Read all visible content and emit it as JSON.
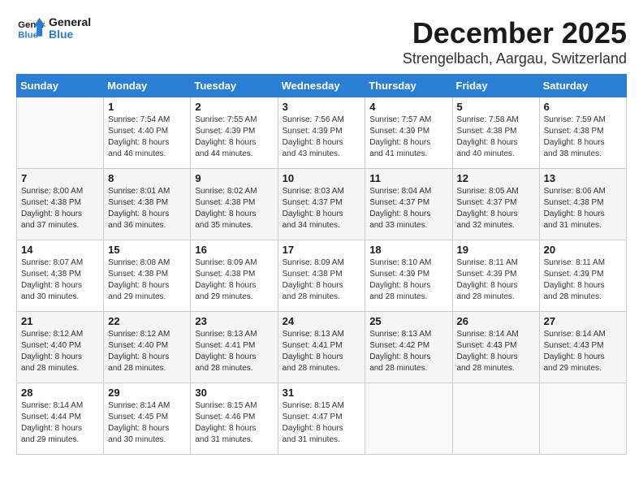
{
  "logo": {
    "line1": "General",
    "line2": "Blue"
  },
  "title": "December 2025",
  "location": "Strengelbach, Aargau, Switzerland",
  "weekdays": [
    "Sunday",
    "Monday",
    "Tuesday",
    "Wednesday",
    "Thursday",
    "Friday",
    "Saturday"
  ],
  "weeks": [
    [
      {
        "day": "",
        "info": ""
      },
      {
        "day": "1",
        "info": "Sunrise: 7:54 AM\nSunset: 4:40 PM\nDaylight: 8 hours\nand 46 minutes."
      },
      {
        "day": "2",
        "info": "Sunrise: 7:55 AM\nSunset: 4:39 PM\nDaylight: 8 hours\nand 44 minutes."
      },
      {
        "day": "3",
        "info": "Sunrise: 7:56 AM\nSunset: 4:39 PM\nDaylight: 8 hours\nand 43 minutes."
      },
      {
        "day": "4",
        "info": "Sunrise: 7:57 AM\nSunset: 4:39 PM\nDaylight: 8 hours\nand 41 minutes."
      },
      {
        "day": "5",
        "info": "Sunrise: 7:58 AM\nSunset: 4:38 PM\nDaylight: 8 hours\nand 40 minutes."
      },
      {
        "day": "6",
        "info": "Sunrise: 7:59 AM\nSunset: 4:38 PM\nDaylight: 8 hours\nand 38 minutes."
      }
    ],
    [
      {
        "day": "7",
        "info": "Sunrise: 8:00 AM\nSunset: 4:38 PM\nDaylight: 8 hours\nand 37 minutes."
      },
      {
        "day": "8",
        "info": "Sunrise: 8:01 AM\nSunset: 4:38 PM\nDaylight: 8 hours\nand 36 minutes."
      },
      {
        "day": "9",
        "info": "Sunrise: 8:02 AM\nSunset: 4:38 PM\nDaylight: 8 hours\nand 35 minutes."
      },
      {
        "day": "10",
        "info": "Sunrise: 8:03 AM\nSunset: 4:37 PM\nDaylight: 8 hours\nand 34 minutes."
      },
      {
        "day": "11",
        "info": "Sunrise: 8:04 AM\nSunset: 4:37 PM\nDaylight: 8 hours\nand 33 minutes."
      },
      {
        "day": "12",
        "info": "Sunrise: 8:05 AM\nSunset: 4:37 PM\nDaylight: 8 hours\nand 32 minutes."
      },
      {
        "day": "13",
        "info": "Sunrise: 8:06 AM\nSunset: 4:38 PM\nDaylight: 8 hours\nand 31 minutes."
      }
    ],
    [
      {
        "day": "14",
        "info": "Sunrise: 8:07 AM\nSunset: 4:38 PM\nDaylight: 8 hours\nand 30 minutes."
      },
      {
        "day": "15",
        "info": "Sunrise: 8:08 AM\nSunset: 4:38 PM\nDaylight: 8 hours\nand 29 minutes."
      },
      {
        "day": "16",
        "info": "Sunrise: 8:09 AM\nSunset: 4:38 PM\nDaylight: 8 hours\nand 29 minutes."
      },
      {
        "day": "17",
        "info": "Sunrise: 8:09 AM\nSunset: 4:38 PM\nDaylight: 8 hours\nand 28 minutes."
      },
      {
        "day": "18",
        "info": "Sunrise: 8:10 AM\nSunset: 4:39 PM\nDaylight: 8 hours\nand 28 minutes."
      },
      {
        "day": "19",
        "info": "Sunrise: 8:11 AM\nSunset: 4:39 PM\nDaylight: 8 hours\nand 28 minutes."
      },
      {
        "day": "20",
        "info": "Sunrise: 8:11 AM\nSunset: 4:39 PM\nDaylight: 8 hours\nand 28 minutes."
      }
    ],
    [
      {
        "day": "21",
        "info": "Sunrise: 8:12 AM\nSunset: 4:40 PM\nDaylight: 8 hours\nand 28 minutes."
      },
      {
        "day": "22",
        "info": "Sunrise: 8:12 AM\nSunset: 4:40 PM\nDaylight: 8 hours\nand 28 minutes."
      },
      {
        "day": "23",
        "info": "Sunrise: 8:13 AM\nSunset: 4:41 PM\nDaylight: 8 hours\nand 28 minutes."
      },
      {
        "day": "24",
        "info": "Sunrise: 8:13 AM\nSunset: 4:41 PM\nDaylight: 8 hours\nand 28 minutes."
      },
      {
        "day": "25",
        "info": "Sunrise: 8:13 AM\nSunset: 4:42 PM\nDaylight: 8 hours\nand 28 minutes."
      },
      {
        "day": "26",
        "info": "Sunrise: 8:14 AM\nSunset: 4:43 PM\nDaylight: 8 hours\nand 28 minutes."
      },
      {
        "day": "27",
        "info": "Sunrise: 8:14 AM\nSunset: 4:43 PM\nDaylight: 8 hours\nand 29 minutes."
      }
    ],
    [
      {
        "day": "28",
        "info": "Sunrise: 8:14 AM\nSunset: 4:44 PM\nDaylight: 8 hours\nand 29 minutes."
      },
      {
        "day": "29",
        "info": "Sunrise: 8:14 AM\nSunset: 4:45 PM\nDaylight: 8 hours\nand 30 minutes."
      },
      {
        "day": "30",
        "info": "Sunrise: 8:15 AM\nSunset: 4:46 PM\nDaylight: 8 hours\nand 31 minutes."
      },
      {
        "day": "31",
        "info": "Sunrise: 8:15 AM\nSunset: 4:47 PM\nDaylight: 8 hours\nand 31 minutes."
      },
      {
        "day": "",
        "info": ""
      },
      {
        "day": "",
        "info": ""
      },
      {
        "day": "",
        "info": ""
      }
    ]
  ]
}
